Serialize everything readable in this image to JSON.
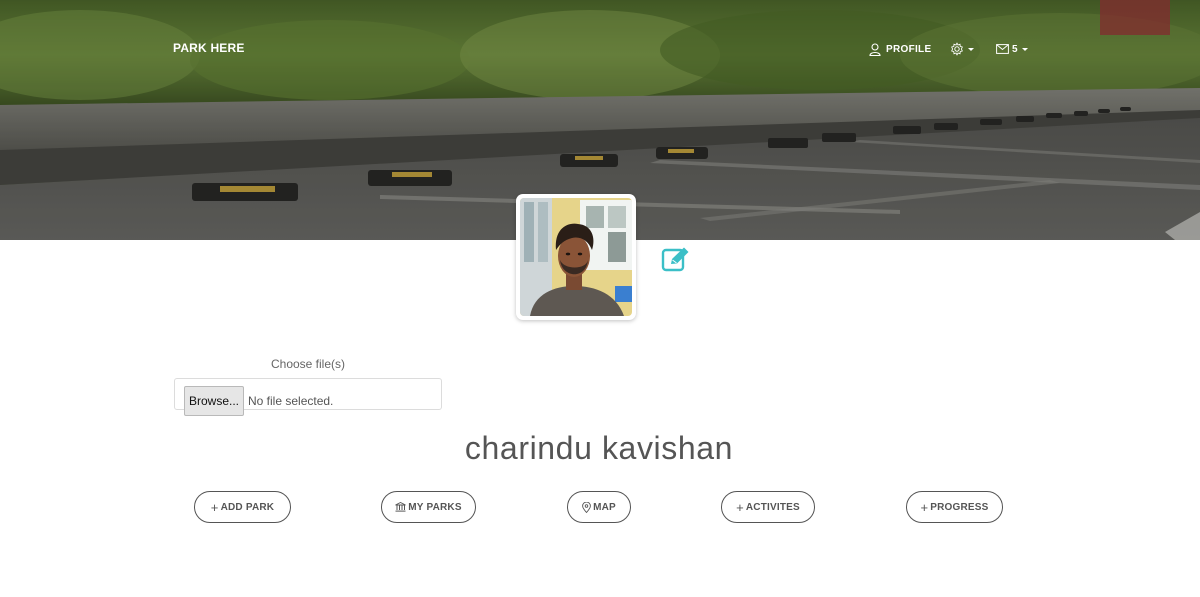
{
  "navbar": {
    "brand": "PARK HERE",
    "profile_label": "PROFILE",
    "mail_count": "5"
  },
  "icons": {
    "profile": "user-icon",
    "settings": "gear-icon",
    "mail": "envelope-icon",
    "edit": "edit-icon",
    "add": "plus-icon",
    "my_parks": "bank-icon",
    "map": "map-pin-icon"
  },
  "colors": {
    "edit_accent": "#3bbfc7",
    "pill_border": "#555555"
  },
  "upload": {
    "label": "Choose file(s)",
    "button_label": "Browse...",
    "status": "No file selected."
  },
  "user": {
    "name": "charindu kavishan"
  },
  "actions": [
    {
      "label": "ADD PARK"
    },
    {
      "label": "MY PARKS"
    },
    {
      "label": "MAP"
    },
    {
      "label": "ACTIVITES"
    },
    {
      "label": "PROGRESS"
    }
  ]
}
